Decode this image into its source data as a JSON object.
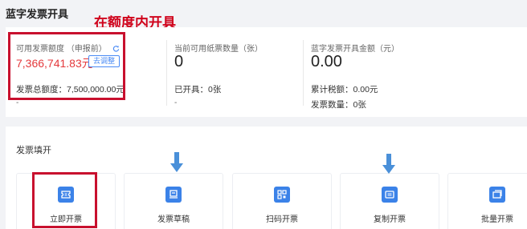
{
  "page": {
    "title": "蓝字发票开具"
  },
  "annotation": {
    "text": "在额度内开具"
  },
  "stats": {
    "available": {
      "label": "可用发票额度 （申报前）",
      "value": "7,366,741.83元",
      "adjust_label": "去调整",
      "total_label": "发票总额度：",
      "total_value": "7,500,000.00元",
      "dash": "-"
    },
    "paper": {
      "label": "当前可用纸票数量（张）",
      "value": "0",
      "issued_label": "已开具：",
      "issued_value": "0张",
      "dash": "-"
    },
    "amount": {
      "label": "蓝字发票开具金额（元）",
      "value": "0.00",
      "tax_label": "累计税额：",
      "tax_value": "0.00元",
      "count_label": "发票数量：",
      "count_value": "0张"
    }
  },
  "fill": {
    "title": "发票填开",
    "actions": [
      {
        "label": "立即开票",
        "icon": "ticket-icon"
      },
      {
        "label": "发票草稿",
        "icon": "draft-icon"
      },
      {
        "label": "扫码开票",
        "icon": "qrcode-icon"
      },
      {
        "label": "复制开票",
        "icon": "copy-icon"
      },
      {
        "label": "批量开票",
        "icon": "batch-icon"
      }
    ]
  },
  "colors": {
    "accent": "#3b82e8",
    "highlight": "#c8102e",
    "amount_red": "#e4393c",
    "arrow": "#4a90d9"
  }
}
